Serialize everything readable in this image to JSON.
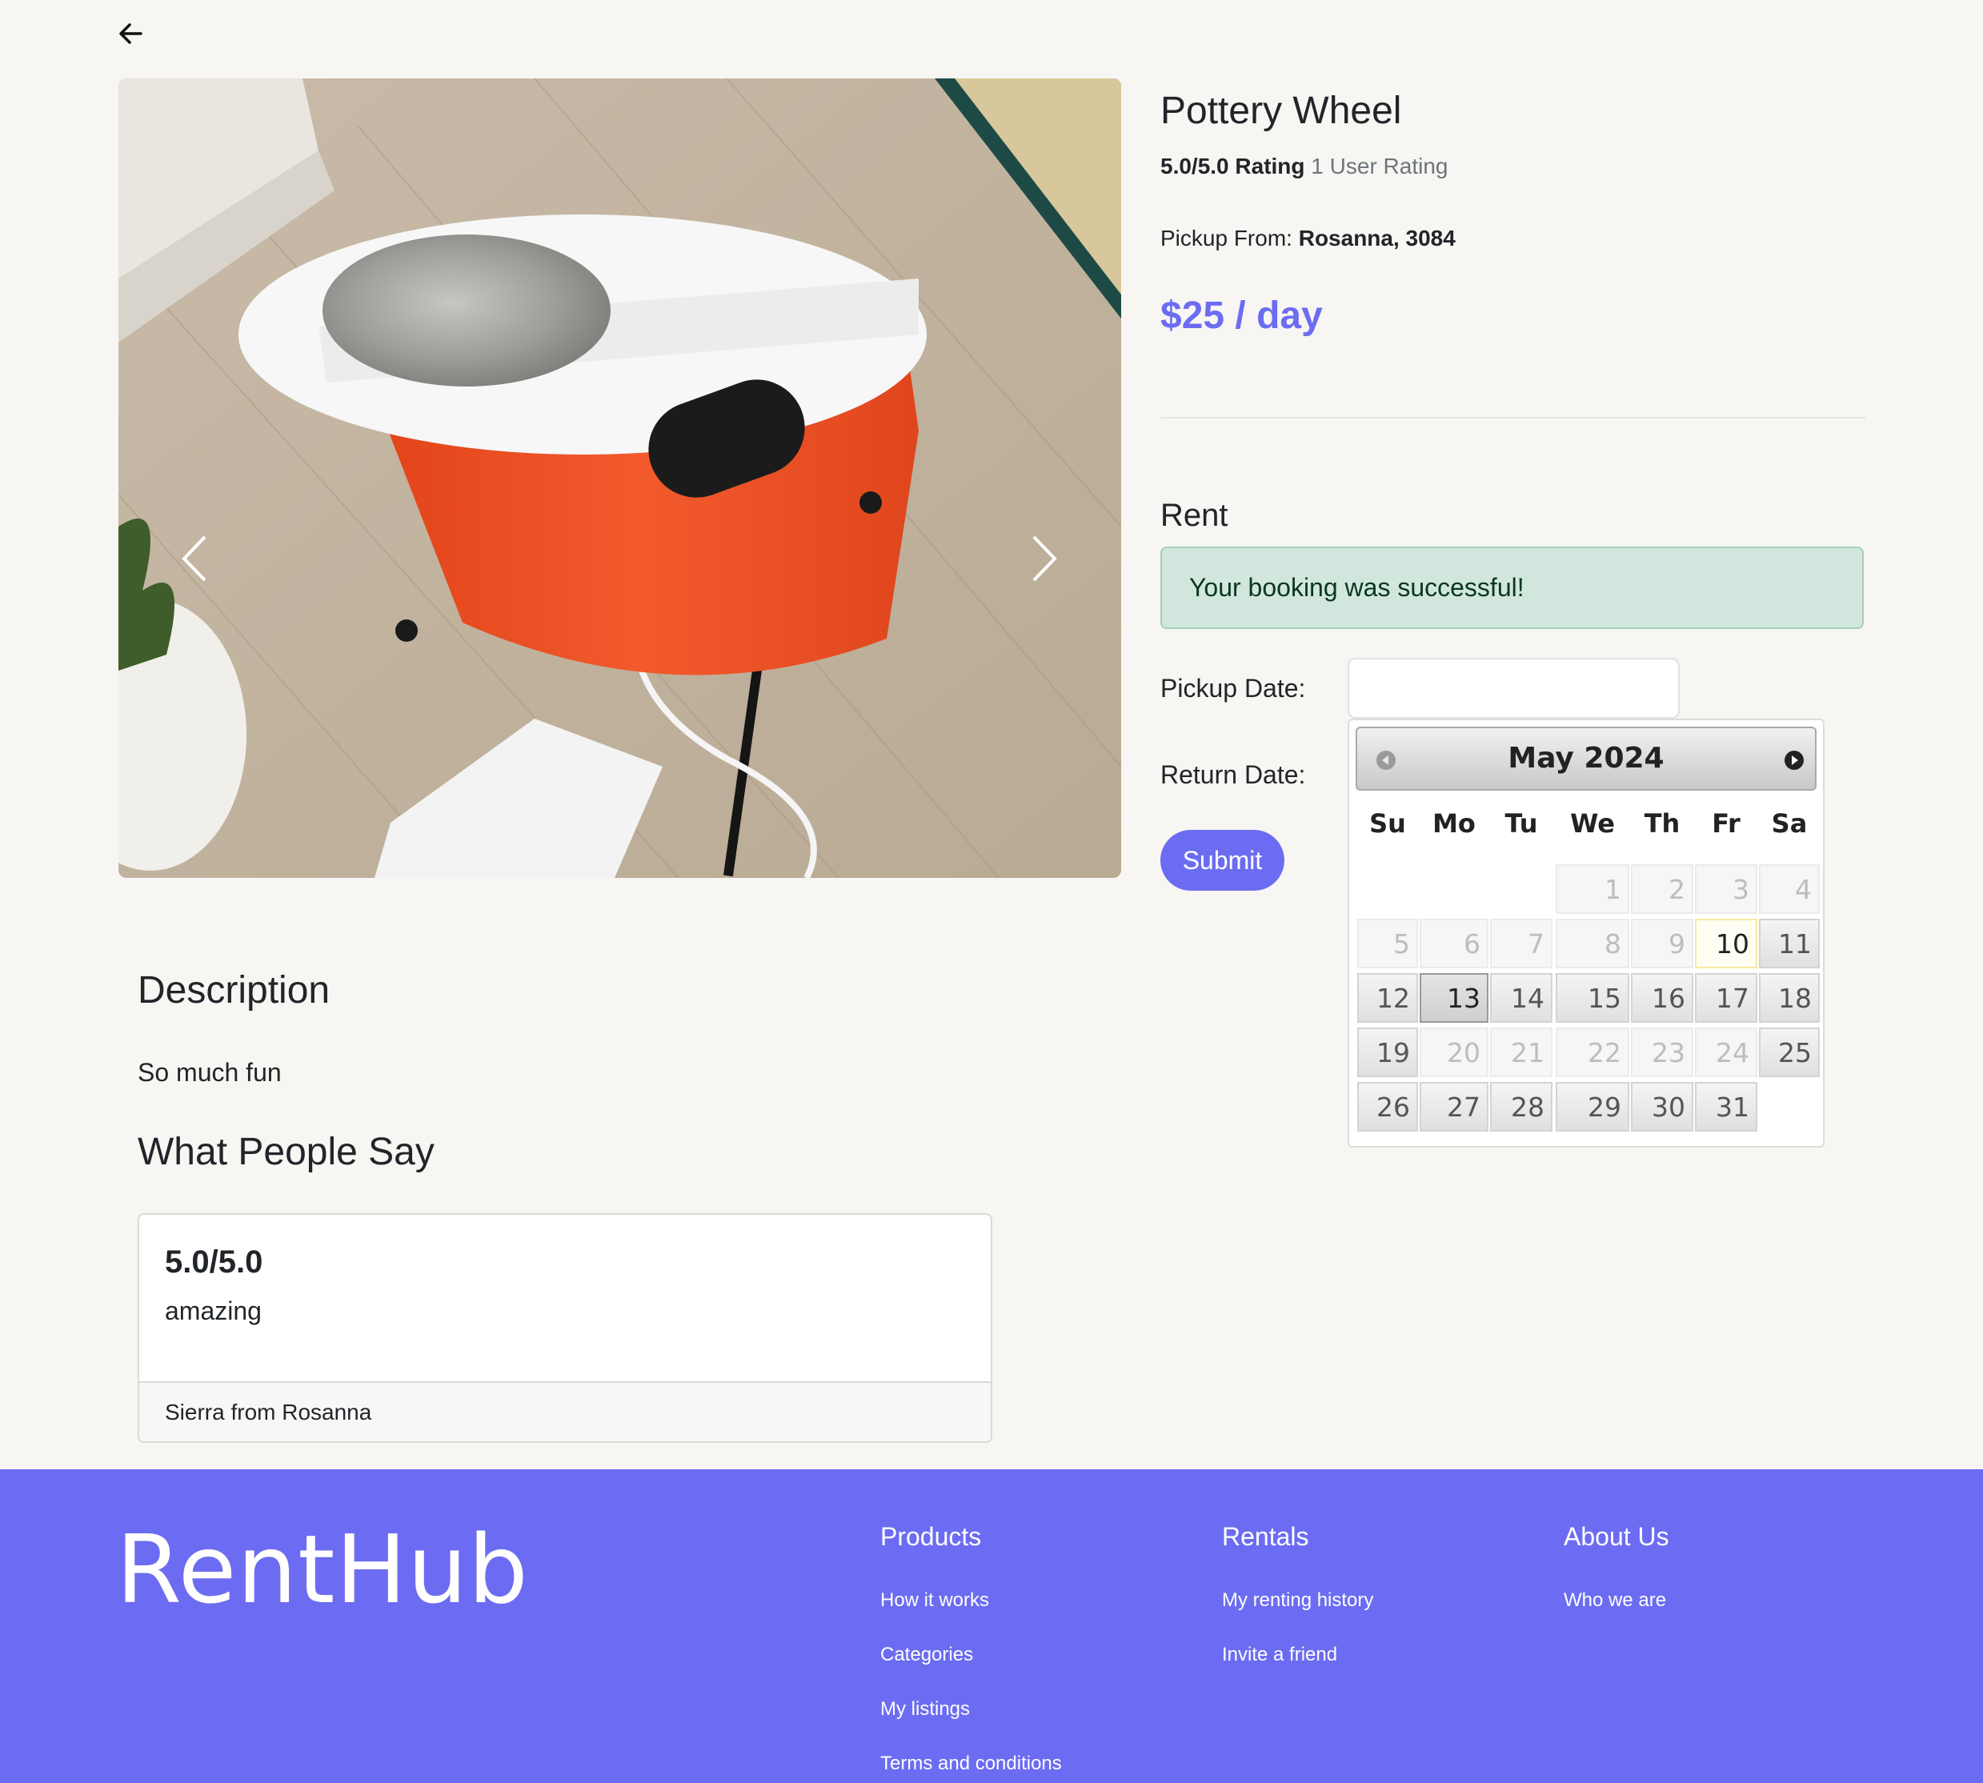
{
  "product": {
    "title": "Pottery Wheel",
    "rating_value": "5.0/5.0 Rating",
    "rating_count": "1 User Rating",
    "pickup_label": "Pickup From:",
    "pickup_location": "Rosanna, 3084",
    "price": "$25 / day"
  },
  "rent": {
    "title": "Rent",
    "alert": "Your booking was successful!",
    "pickup_label": "Pickup Date:",
    "return_label": "Return Date:",
    "pickup_value": "",
    "submit_label": "Submit"
  },
  "datepicker": {
    "title": "May 2024",
    "weekdays": [
      "Su",
      "Mo",
      "Tu",
      "We",
      "Th",
      "Fr",
      "Sa"
    ],
    "days": [
      "1",
      "2",
      "3",
      "4",
      "5",
      "6",
      "7",
      "8",
      "9",
      "10",
      "11",
      "12",
      "13",
      "14",
      "15",
      "16",
      "17",
      "18",
      "19",
      "20",
      "21",
      "22",
      "23",
      "24",
      "25",
      "26",
      "27",
      "28",
      "29",
      "30",
      "31"
    ],
    "today": "10",
    "selected": "13"
  },
  "description": {
    "title": "Description",
    "text": "So much fun"
  },
  "reviews": {
    "title": "What People Say",
    "items": [
      {
        "rating": "5.0/5.0",
        "text": "amazing",
        "author": "Sierra from Rosanna"
      }
    ]
  },
  "footer": {
    "logo": "RentHub",
    "columns": [
      {
        "title": "Products",
        "links": [
          "How it works",
          "Categories",
          "My listings",
          "Terms and conditions"
        ]
      },
      {
        "title": "Rentals",
        "links": [
          "My renting history",
          "Invite a friend"
        ]
      },
      {
        "title": "About Us",
        "links": [
          "Who we are"
        ]
      }
    ]
  },
  "colors": {
    "accent": "#6c6cf2",
    "success_bg": "#d1e7dd",
    "page_bg": "#f7f6f3"
  },
  "icons": {
    "back": "arrow-left-icon",
    "carousel_prev": "chevron-left-icon",
    "carousel_next": "chevron-right-icon",
    "dp_prev": "circle-triangle-left-icon",
    "dp_next": "circle-triangle-right-icon"
  }
}
